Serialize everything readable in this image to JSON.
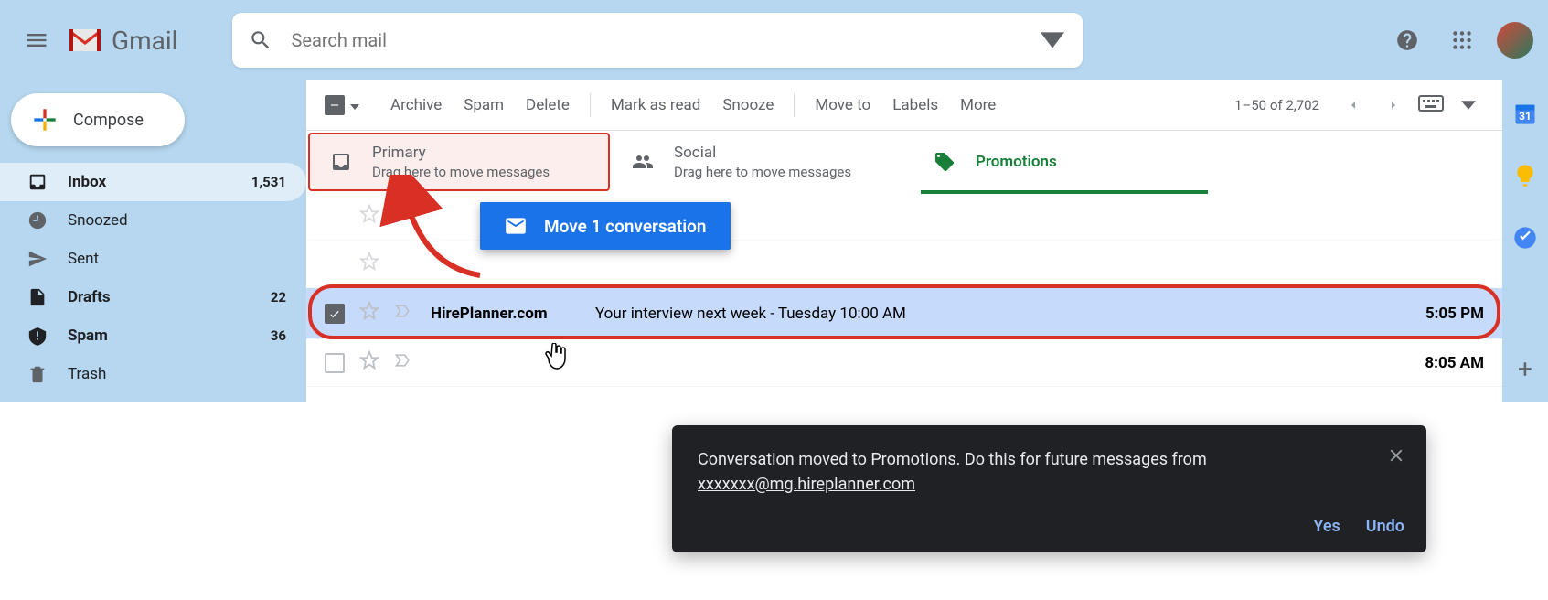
{
  "app": {
    "name": "Gmail"
  },
  "search": {
    "placeholder": "Search mail"
  },
  "compose": {
    "label": "Compose"
  },
  "nav": {
    "inbox": {
      "label": "Inbox",
      "count": "1,531"
    },
    "snoozed": {
      "label": "Snoozed"
    },
    "sent": {
      "label": "Sent"
    },
    "drafts": {
      "label": "Drafts",
      "count": "22"
    },
    "spam": {
      "label": "Spam",
      "count": "36"
    },
    "trash": {
      "label": "Trash"
    }
  },
  "toolbar": {
    "archive": "Archive",
    "spam": "Spam",
    "delete": "Delete",
    "mark_read": "Mark as read",
    "snooze": "Snooze",
    "move_to": "Move to",
    "labels": "Labels",
    "more": "More",
    "pager": "1–50 of 2,702"
  },
  "tabs": {
    "primary": {
      "label": "Primary",
      "sub": "Drag here to move messages"
    },
    "social": {
      "label": "Social",
      "sub": "Drag here to move messages"
    },
    "promotions": {
      "label": "Promotions"
    }
  },
  "drag": {
    "text": "Move 1 conversation"
  },
  "emails": {
    "selected": {
      "sender": "HirePlanner.com",
      "subject": "Your interview next week - Tuesday 10:00 AM",
      "time": "5:05 PM"
    },
    "below": {
      "time": "8:05 AM"
    }
  },
  "toast": {
    "line1": "Conversation moved to Promotions. Do this for future messages from",
    "email": "xxxxxxx@mg.hireplanner.com",
    "yes": "Yes",
    "undo": "Undo"
  }
}
